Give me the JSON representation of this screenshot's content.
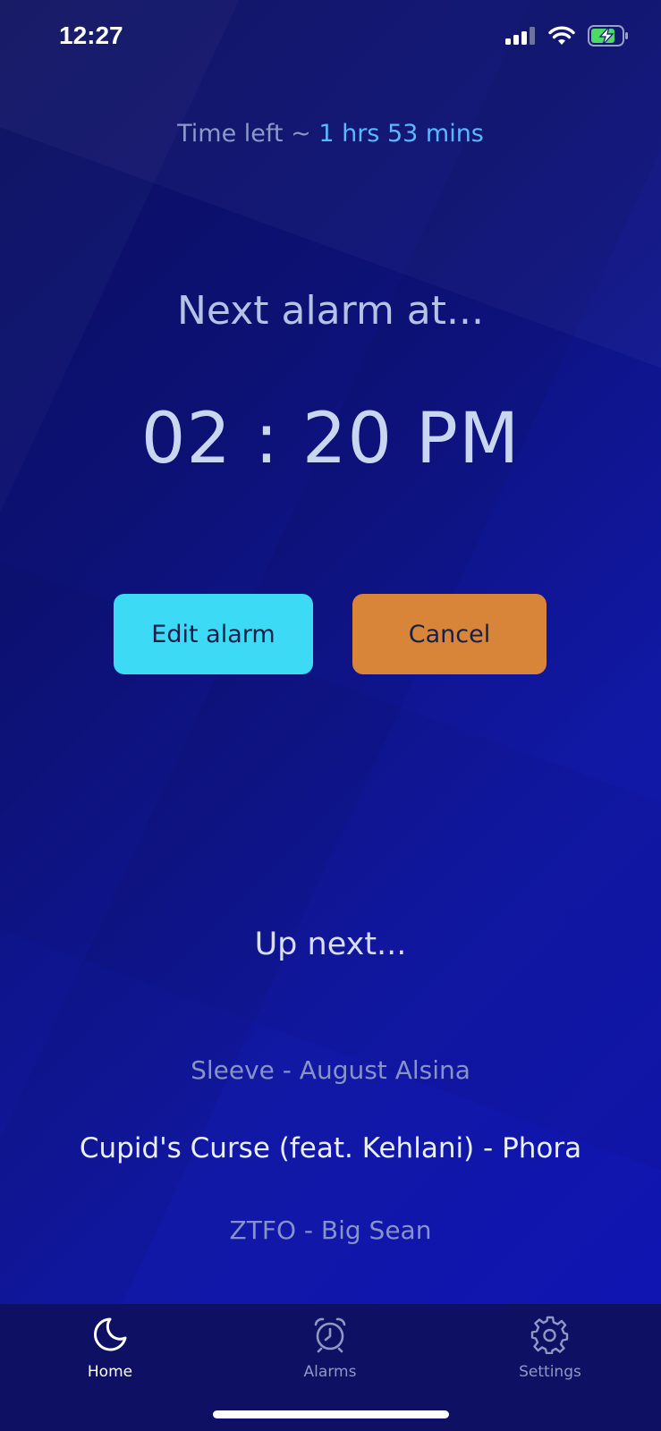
{
  "status_bar": {
    "time": "12:27",
    "icons": [
      "signal-icon",
      "wifi-icon",
      "battery-charging-icon"
    ],
    "battery_color": "#4cd964"
  },
  "time_left": {
    "label": "Time left ~",
    "value": "1 hrs 53 mins"
  },
  "next_alarm": {
    "title": "Next alarm at...",
    "time": "02 : 20 PM"
  },
  "buttons": {
    "edit_label": "Edit alarm",
    "cancel_label": "Cancel"
  },
  "up_next": {
    "title": "Up next...",
    "tracks": [
      "Sleeve - August Alsina",
      "Cupid's Curse (feat. Kehlani) - Phora",
      "ZTFO - Big Sean"
    ]
  },
  "tab_bar": {
    "tabs": [
      {
        "label": "Home",
        "icon": "moon-icon",
        "active": true
      },
      {
        "label": "Alarms",
        "icon": "alarm-clock-icon",
        "active": false
      },
      {
        "label": "Settings",
        "icon": "gear-icon",
        "active": false
      }
    ]
  },
  "colors": {
    "accent_blue": "#5ab8ff",
    "edit_button": "#3cdaf4",
    "cancel_button": "#d8853a",
    "background": "#0c1174"
  }
}
